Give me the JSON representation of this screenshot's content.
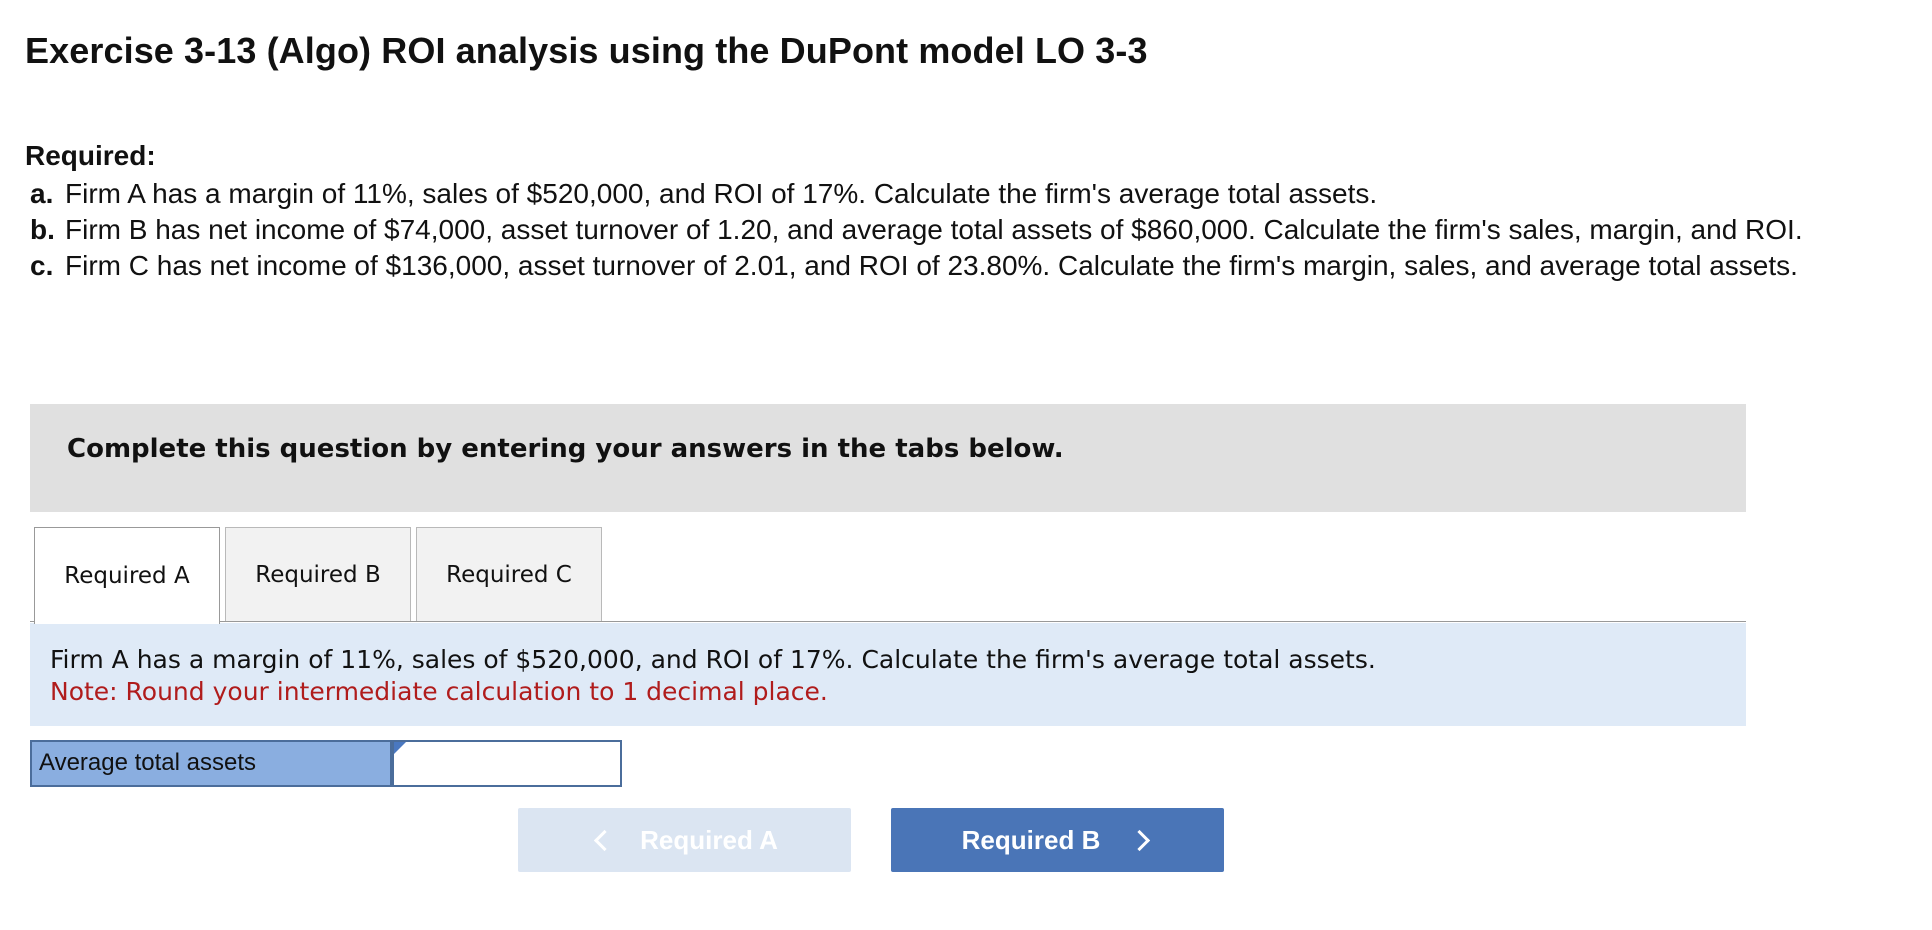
{
  "header": {
    "title": "Exercise 3-13 (Algo) ROI analysis using the DuPont model LO 3-3"
  },
  "requirements": {
    "heading": "Required:",
    "items": [
      {
        "letter": "a.",
        "text": "Firm A has a margin of 11%, sales of $520,000, and ROI of 17%. Calculate the firm's average total assets."
      },
      {
        "letter": "b.",
        "text": "Firm B has net income of $74,000, asset turnover of 1.20, and average total assets of $860,000. Calculate the firm's sales, margin, and ROI."
      },
      {
        "letter": "c.",
        "text": "Firm C has net income of $136,000, asset turnover of 2.01, and ROI of 23.80%. Calculate the firm's margin, sales, and average total assets."
      }
    ]
  },
  "instructions": {
    "text": "Complete this question by entering your answers in the tabs below."
  },
  "tabs": [
    {
      "label": "Required A",
      "active": true
    },
    {
      "label": "Required B",
      "active": false
    },
    {
      "label": "Required C",
      "active": false
    }
  ],
  "question": {
    "text": "Firm A has a margin of 11%, sales of $520,000, and ROI of 17%. Calculate the firm's average total assets.",
    "note": "Note: Round your intermediate calculation to 1 decimal place."
  },
  "answer": {
    "label": "Average total assets",
    "value": ""
  },
  "navigation": {
    "prev_label": "Required A",
    "next_label": "Required B"
  },
  "colors": {
    "instruction_bg": "#e0e0e0",
    "question_bg": "#dfeaf7",
    "note_text": "#b01c1c",
    "answer_label_bg": "#8aaee0",
    "next_button_bg": "#4a75b7",
    "prev_button_bg": "#dbe5f2"
  }
}
